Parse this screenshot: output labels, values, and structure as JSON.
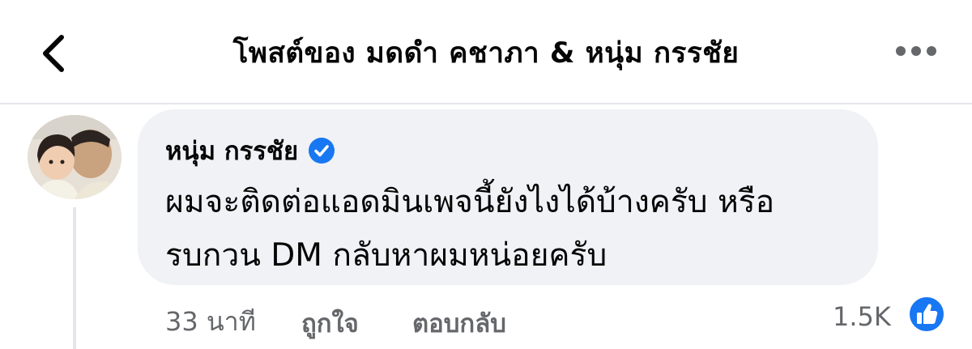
{
  "header": {
    "title": "โพสต์ของ มดดำ คชาภา & หนุ่ม กรรชัย",
    "back_icon": "chevron-left-icon",
    "more_icon": "more-horizontal-icon"
  },
  "comment": {
    "author": "หนุ่ม กรรชัย",
    "verified_icon": "verified-badge-icon",
    "text_line1": "ผมจะติดต่อแอดมินเพจนี้ยังไงได้บ้างครับ หรือ",
    "text_line2": "รบกวน DM กลับหาผมหน่อยครับ",
    "time": "33 นาที",
    "like_label": "ถูกใจ",
    "reply_label": "ตอบกลับ",
    "reaction_count": "1.5K",
    "reaction_icon": "like-reaction-icon"
  },
  "colors": {
    "accent": "#1877f2",
    "bubble": "#f0f2f5",
    "meta_text": "#65676b",
    "divider": "#e4e6eb"
  }
}
